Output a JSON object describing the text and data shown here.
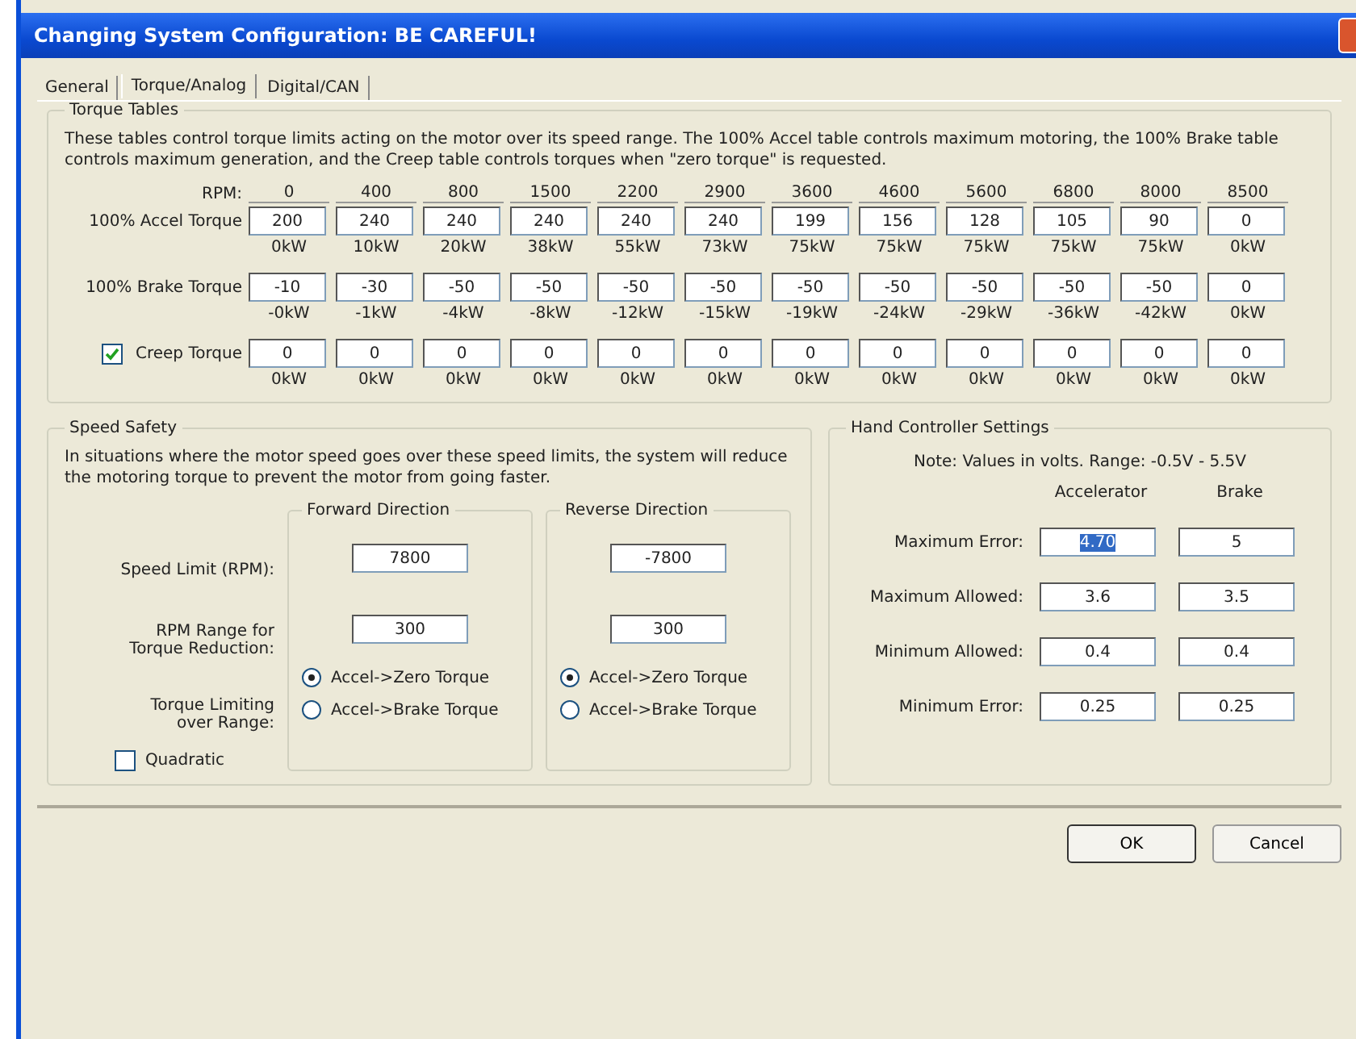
{
  "window": {
    "title": "Changing System Configuration: BE CAREFUL!"
  },
  "tabs": [
    {
      "label": "General",
      "selected": false
    },
    {
      "label": "Torque/Analog",
      "selected": true
    },
    {
      "label": "Digital/CAN",
      "selected": false
    }
  ],
  "torque_tables": {
    "title": "Torque Tables",
    "description": "These tables control torque limits acting on the motor over its speed range. The 100% Accel table controls maximum motoring, the 100% Brake table controls maximum generation, and the Creep table controls torques when \"zero torque\" is requested.",
    "rpm_label": "RPM:",
    "rpm": [
      "0",
      "400",
      "800",
      "1500",
      "2200",
      "2900",
      "3600",
      "4600",
      "5600",
      "6800",
      "8000",
      "8500"
    ],
    "rows": [
      {
        "kind": "plain",
        "label": "100% Accel Torque",
        "values": [
          "200",
          "240",
          "240",
          "240",
          "240",
          "240",
          "199",
          "156",
          "128",
          "105",
          "90",
          "0"
        ],
        "power": [
          "0kW",
          "10kW",
          "20kW",
          "38kW",
          "55kW",
          "73kW",
          "75kW",
          "75kW",
          "75kW",
          "75kW",
          "75kW",
          "0kW"
        ]
      },
      {
        "kind": "plain",
        "label": "100% Brake Torque",
        "values": [
          "-10",
          "-30",
          "-50",
          "-50",
          "-50",
          "-50",
          "-50",
          "-50",
          "-50",
          "-50",
          "-50",
          "0"
        ],
        "power": [
          "-0kW",
          "-1kW",
          "-4kW",
          "-8kW",
          "-12kW",
          "-15kW",
          "-19kW",
          "-24kW",
          "-29kW",
          "-36kW",
          "-42kW",
          "0kW"
        ]
      },
      {
        "kind": "checkbox",
        "checked": true,
        "label": "Creep Torque",
        "values": [
          "0",
          "0",
          "0",
          "0",
          "0",
          "0",
          "0",
          "0",
          "0",
          "0",
          "0",
          "0"
        ],
        "power": [
          "0kW",
          "0kW",
          "0kW",
          "0kW",
          "0kW",
          "0kW",
          "0kW",
          "0kW",
          "0kW",
          "0kW",
          "0kW",
          "0kW"
        ]
      }
    ]
  },
  "speed_safety": {
    "title": "Speed Safety",
    "description": "In situations where the motor speed goes over these speed limits, the system will reduce the motoring torque to prevent the motor from going faster.",
    "speed_limit_label": "Speed Limit (RPM):",
    "rpm_range_label": "RPM Range for Torque Reduction:",
    "limiting_label": "Torque Limiting over Range:",
    "quadratic": {
      "label": "Quadratic",
      "checked": false
    },
    "directions": [
      {
        "title": "Forward Direction",
        "speed_limit": "7800",
        "rpm_range": "300",
        "options": [
          {
            "label": "Accel->Zero Torque",
            "selected": true
          },
          {
            "label": "Accel->Brake Torque",
            "selected": false
          }
        ]
      },
      {
        "title": "Reverse Direction",
        "speed_limit": "-7800",
        "rpm_range": "300",
        "options": [
          {
            "label": "Accel->Zero Torque",
            "selected": true
          },
          {
            "label": "Accel->Brake Torque",
            "selected": false
          }
        ]
      }
    ]
  },
  "hand_controller": {
    "title": "Hand Controller Settings",
    "note": "Note: Values in volts. Range: -0.5V - 5.5V",
    "columns": [
      "Accelerator",
      "Brake"
    ],
    "rows": [
      {
        "label": "Maximum Error:",
        "values": [
          {
            "text": "4.70",
            "selected": true
          },
          {
            "text": "5",
            "selected": false
          }
        ]
      },
      {
        "label": "Maximum Allowed:",
        "values": [
          {
            "text": "3.6",
            "selected": false
          },
          {
            "text": "3.5",
            "selected": false
          }
        ]
      },
      {
        "label": "Minimum Allowed:",
        "values": [
          {
            "text": "0.4",
            "selected": false
          },
          {
            "text": "0.4",
            "selected": false
          }
        ]
      },
      {
        "label": "Minimum Error:",
        "values": [
          {
            "text": "0.25",
            "selected": false
          },
          {
            "text": "0.25",
            "selected": false
          }
        ]
      }
    ]
  },
  "buttons": [
    {
      "label": "OK",
      "kind": "default"
    },
    {
      "label": "Cancel",
      "kind": "normal"
    }
  ]
}
